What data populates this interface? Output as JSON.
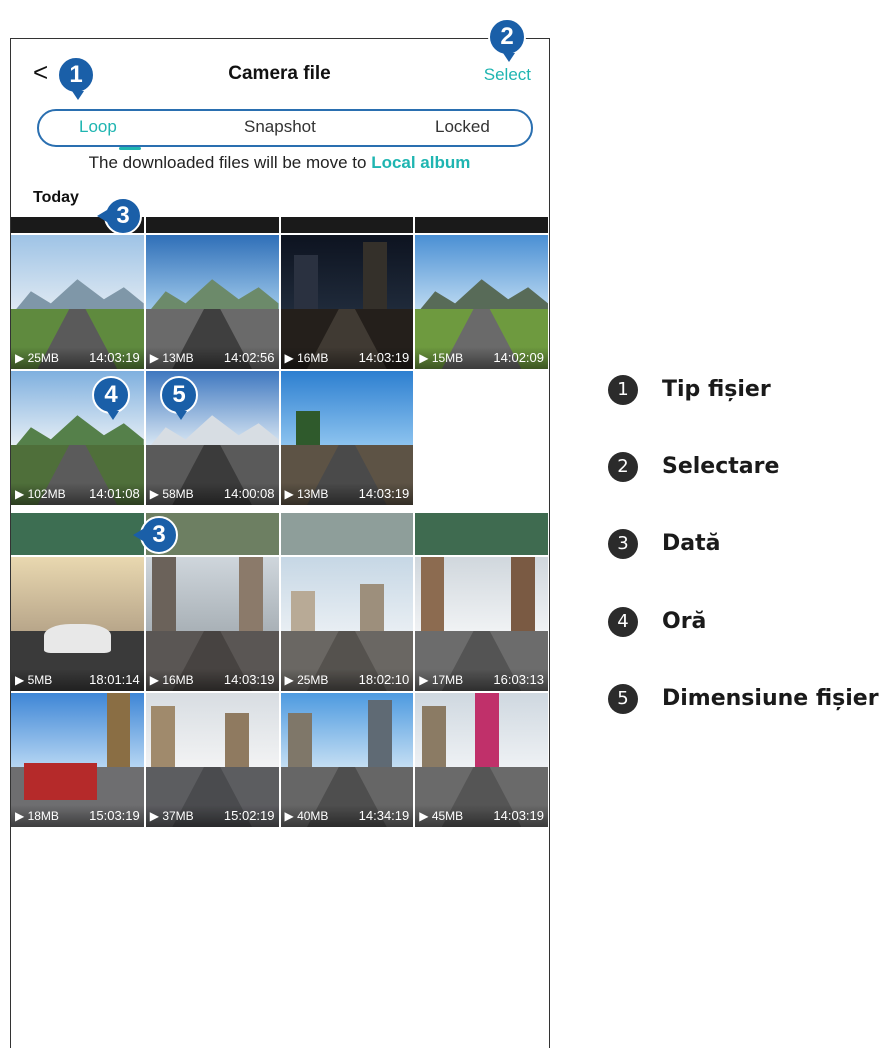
{
  "header": {
    "back_icon": "chevron-left-icon",
    "back_glyph": "<",
    "title": "Camera file",
    "select_label": "Select"
  },
  "tabs": [
    {
      "label": "Loop",
      "active": true
    },
    {
      "label": "Snapshot",
      "active": false
    },
    {
      "label": "Locked",
      "active": false
    }
  ],
  "notice": {
    "text": "The downloaded files will be move to",
    "link": "Local album"
  },
  "section_date": "Today",
  "files_group1": [
    {
      "size": "▶ 25MB",
      "time": "14:03:19"
    },
    {
      "size": "▶ 13MB",
      "time": "14:02:56"
    },
    {
      "size": "▶ 16MB",
      "time": "14:03:19"
    },
    {
      "size": "▶ 15MB",
      "time": "14:02:09"
    },
    {
      "size": "▶ 102MB",
      "time": "14:01:08"
    },
    {
      "size": "▶ 58MB",
      "time": "14:00:08"
    },
    {
      "size": "▶ 13MB",
      "time": "14:03:19"
    }
  ],
  "files_group2": [
    {
      "size": "▶ 5MB",
      "time": "18:01:14"
    },
    {
      "size": "▶ 16MB",
      "time": "14:03:19"
    },
    {
      "size": "▶ 25MB",
      "time": "18:02:10"
    },
    {
      "size": "▶ 17MB",
      "time": "16:03:13"
    },
    {
      "size": "▶ 18MB",
      "time": "15:03:19"
    },
    {
      "size": "▶ 37MB",
      "time": "15:02:19"
    },
    {
      "size": "▶ 40MB",
      "time": "14:34:19"
    },
    {
      "size": "▶ 45MB",
      "time": "14:03:19"
    }
  ],
  "badges": {
    "b1": "1",
    "b2": "2",
    "b3a": "3",
    "b3b": "3",
    "b4": "4",
    "b5": "5"
  },
  "legend": [
    {
      "num": "1",
      "label": "Tip fișier"
    },
    {
      "num": "2",
      "label": "Selectare"
    },
    {
      "num": "3",
      "label": "Dată"
    },
    {
      "num": "4",
      "label": "Oră"
    },
    {
      "num": "5",
      "label": "Dimensiune fișier"
    }
  ],
  "colors": {
    "accent": "#1fb5b1",
    "badge": "#1a5fa8",
    "legend_circle": "#2b2b2b"
  }
}
